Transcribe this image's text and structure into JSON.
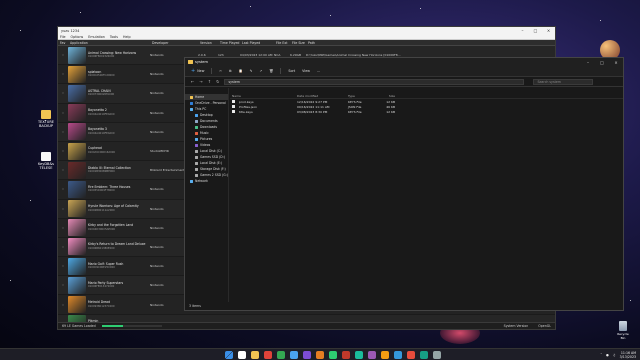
{
  "desktop": {
    "icons": [
      {
        "label": "TEXTURE\nBACKUP"
      },
      {
        "label": "KeyDB&s TELESE"
      }
    ],
    "recycle_bin": "Recycle Bin"
  },
  "yuzu": {
    "title": "yuzu 1234",
    "menu": [
      "File",
      "Options",
      "Emulation",
      "Tools",
      "Help"
    ],
    "columns": [
      "Fav",
      "Application",
      "Developer",
      "Version",
      "Time Played",
      "Last Played",
      "File Ext",
      "File Size",
      "Path"
    ],
    "games": [
      {
        "name": "Animal Crossing: New Horizons",
        "id": "01006F8002326000",
        "developer": "Nintendo",
        "version": "2.0.6",
        "time": "12h",
        "last": "04/03/2023 12:00 AM",
        "ext": "NCA",
        "size": "6.29GB",
        "path": "D:\\Yuzu\\NSP\\Games\\Animal Crossing New Horizons [01006F8..."
      },
      {
        "name": "splatoon",
        "id": "0100C2500FC20000",
        "developer": "Nintendo",
        "version": "",
        "time": "",
        "last": "",
        "ext": "",
        "size": "",
        "path": ""
      },
      {
        "name": "ASTRAL CHAIN",
        "id": "01007300020FA000",
        "developer": "Nintendo",
        "version": "",
        "time": "",
        "last": "",
        "ext": "",
        "size": "",
        "path": ""
      },
      {
        "name": "Bayonetta 2",
        "id": "01004A4010FEA000",
        "developer": "Nintendo",
        "version": "",
        "time": "",
        "last": "",
        "ext": "",
        "size": "",
        "path": ""
      },
      {
        "name": "Bayonetta 3",
        "id": "01004A4010FEA000",
        "developer": "Nintendo",
        "version": "",
        "time": "",
        "last": "",
        "ext": "",
        "size": "",
        "path": ""
      },
      {
        "name": "Cuphead",
        "id": "0100A5C00D162000",
        "developer": "StudioMDHR",
        "version": "",
        "time": "",
        "last": "",
        "ext": "",
        "size": "",
        "path": ""
      },
      {
        "name": "Diablo III: Eternal Collection",
        "id": "01001B300B9BE000",
        "developer": "Blizzard Entertainment",
        "version": "",
        "time": "",
        "last": "",
        "ext": "",
        "size": "",
        "path": ""
      },
      {
        "name": "Fire Emblem: Three Houses",
        "id": "010055D009F78000",
        "developer": "Nintendo",
        "version": "",
        "time": "",
        "last": "",
        "ext": "",
        "size": "",
        "path": ""
      },
      {
        "name": "Hyrule Warriors: Age of Calamity",
        "id": "01002B00111A2000",
        "developer": "Nintendo",
        "version": "",
        "time": "",
        "last": "",
        "ext": "",
        "size": "",
        "path": ""
      },
      {
        "name": "Kirby and the Forgotten Land",
        "id": "01004D300C5AE000",
        "developer": "Nintendo",
        "version": "",
        "time": "",
        "last": "",
        "ext": "",
        "size": "",
        "path": ""
      },
      {
        "name": "Kirby's Return to Dream Land Deluxe",
        "id": "01006B601380E000",
        "developer": "Nintendo",
        "version": "",
        "time": "",
        "last": "",
        "ext": "",
        "size": "",
        "path": ""
      },
      {
        "name": "Mario Golf: Super Rush",
        "id": "0100C9C00E25C000",
        "developer": "Nintendo",
        "version": "",
        "time": "",
        "last": "",
        "ext": "",
        "size": "",
        "path": ""
      },
      {
        "name": "Mario Party Superstars",
        "id": "01006FE013472000",
        "developer": "Nintendo",
        "version": "",
        "time": "",
        "last": "",
        "ext": "",
        "size": "",
        "path": ""
      },
      {
        "name": "Metroid Dread",
        "id": "010093801237C000",
        "developer": "Nintendo",
        "version": "",
        "time": "",
        "last": "",
        "ext": "",
        "size": "",
        "path": ""
      },
      {
        "name": "Pikmin",
        "id": "0100AA80194B0000",
        "developer": "Nintendo",
        "version": "",
        "time": "",
        "last": "",
        "ext": "",
        "size": "",
        "path": ""
      }
    ],
    "thumb_colors": [
      "#6fb3d9",
      "#e4a23a",
      "#4a6fa8",
      "#8a3b5a",
      "#b84a8a",
      "#c8a34a",
      "#6a2a2a",
      "#3c5a8a",
      "#c9a555",
      "#e48ab5",
      "#f08cc0",
      "#4da7e2",
      "#5a9fd6",
      "#e08a2a",
      "#3a8a4a"
    ],
    "status": {
      "left": "69 LE Games Loaded",
      "progress": 0.35,
      "right": [
        "System Version",
        "OpenGL"
      ]
    }
  },
  "explorer": {
    "title": "system",
    "toolbar": {
      "new": "New",
      "sort": "Sort",
      "view": "View",
      "more": "..."
    },
    "address": "system",
    "search_placeholder": "Search system",
    "nav_items": [
      {
        "label": "Home",
        "color": "#f1c453",
        "sub": false,
        "selected": true
      },
      {
        "label": "OneDrive - Personal",
        "color": "#2f7fd8",
        "sub": false,
        "selected": false
      },
      {
        "label": "This PC",
        "color": "#5ab0f0",
        "sub": false,
        "selected": false
      },
      {
        "label": "Desktop",
        "color": "#4aa3f0",
        "sub": true,
        "selected": false
      },
      {
        "label": "Documents",
        "color": "#8fa8c8",
        "sub": true,
        "selected": false
      },
      {
        "label": "Downloads",
        "color": "#4ac08a",
        "sub": true,
        "selected": false
      },
      {
        "label": "Music",
        "color": "#e06040",
        "sub": true,
        "selected": false
      },
      {
        "label": "Pictures",
        "color": "#5ab0f0",
        "sub": true,
        "selected": false
      },
      {
        "label": "Videos",
        "color": "#8a60d0",
        "sub": true,
        "selected": false
      },
      {
        "label": "Local Disk (C:)",
        "color": "#aaaaaa",
        "sub": true,
        "selected": false
      },
      {
        "label": "Games SSD (D:)",
        "color": "#aaaaaa",
        "sub": true,
        "selected": false
      },
      {
        "label": "Local Disk (E:)",
        "color": "#aaaaaa",
        "sub": true,
        "selected": false
      },
      {
        "label": "Storage Disk (F:)",
        "color": "#aaaaaa",
        "sub": true,
        "selected": false
      },
      {
        "label": "Games 2 SSD (G:)",
        "color": "#aaaaaa",
        "sub": true,
        "selected": false
      },
      {
        "label": "Network",
        "color": "#5ab0f0",
        "sub": false,
        "selected": false
      }
    ],
    "columns": [
      "Name",
      "Date modified",
      "Type",
      "Size"
    ],
    "files": [
      {
        "name": "prod.keys",
        "date": "12/16/2022 9:27 PM",
        "type": "KEYS File",
        "size": "12 KB"
      },
      {
        "name": "Profiles.json",
        "date": "09/16/2022 11:11 AM",
        "type": "JSON File",
        "size": "46 KB"
      },
      {
        "name": "title.keys",
        "date": "03/08/2023 8:30 PM",
        "type": "KEYS File",
        "size": "12 KB"
      }
    ],
    "status": "3 items"
  },
  "taskbar": {
    "app_colors": [
      "#3a8ee6",
      "#ffffff",
      "#f1c453",
      "#e0433a",
      "#34a853",
      "#4aa3f0",
      "#7d4dd6",
      "#e67e22",
      "#2ecc71",
      "#c0392b",
      "#1abc9c",
      "#9b59b6",
      "#f39c12",
      "#3498db",
      "#e74c3c",
      "#16a085",
      "#95a5a6"
    ],
    "time": "11:16 AM",
    "date": "3/13/2023"
  }
}
